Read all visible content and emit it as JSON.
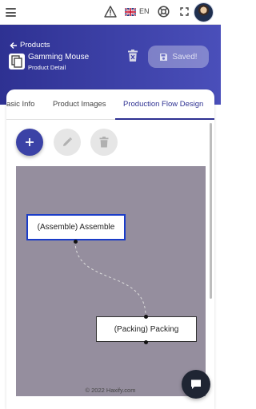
{
  "topbar": {
    "language": "EN"
  },
  "header": {
    "back_label": "Products",
    "product_name": "Gamming Mouse",
    "product_subtitle": "Product Detail",
    "saved_label": "Saved!"
  },
  "tabs": [
    {
      "label": "asic Info"
    },
    {
      "label": "Product Images"
    },
    {
      "label": "Production Flow Design",
      "active": true
    }
  ],
  "flow": {
    "nodes": [
      {
        "label": "(Assemble) Assemble",
        "selected": true
      },
      {
        "label": "(Packing) Packing",
        "selected": false
      }
    ]
  },
  "footer": {
    "copyright": "© 2022 Haxify.com"
  },
  "colors": {
    "primary": "#2e3192",
    "canvas_bg": "#958e9e",
    "selected_border": "#1a3cc8"
  }
}
